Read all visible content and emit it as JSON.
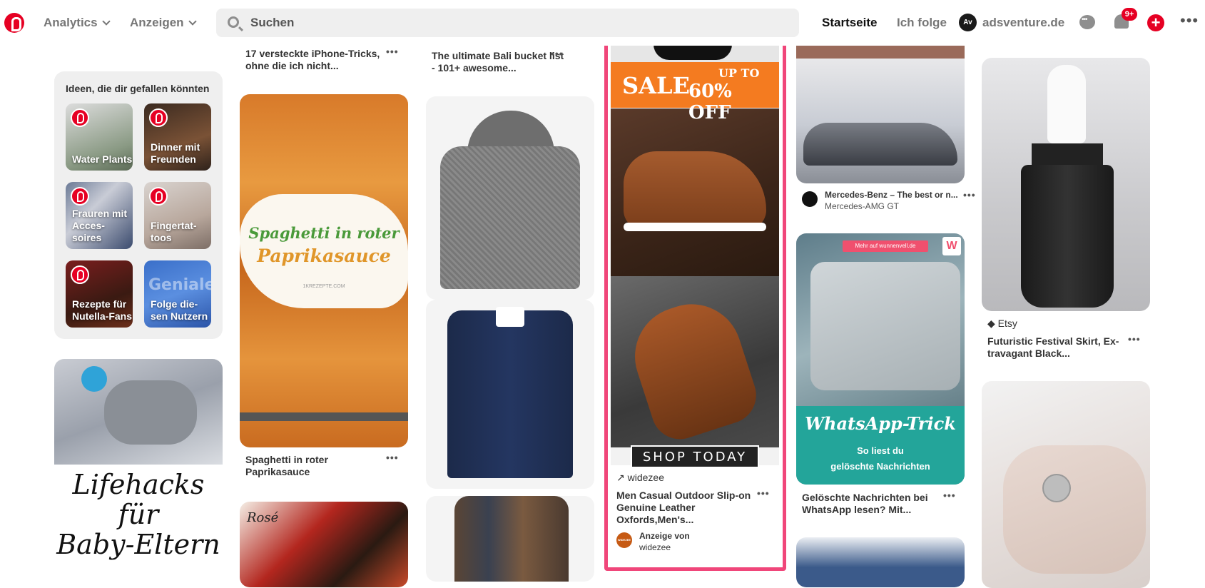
{
  "header": {
    "nav": [
      "Analytics",
      "Anzeigen"
    ],
    "search_placeholder": "Suchen",
    "home": "Startseite",
    "following": "Ich folge",
    "user_name": "adsventure.de",
    "user_avatar_text": "Av",
    "notifications_badge": "9+"
  },
  "ideas": {
    "title": "Ideen, die dir gefallen könnten",
    "items": [
      "Water Plants",
      "Dinner mit Freunden",
      "Frauren mit Acces-soires",
      "Fingertat-toos",
      "Rezepte für Nutella-Fans",
      "Folge die-sen Nutzern"
    ],
    "overlay_word": "Geniale"
  },
  "col1": {
    "pin_text_line1": "Lifehacks",
    "pin_text_line2": "für",
    "pin_text_line3": "Baby-Eltern"
  },
  "col2": {
    "pin1_title": "17 versteckte iPhone-Tricks, ohne die ich nicht...",
    "pin2_overlay_line1": "Spaghetti in roter",
    "pin2_overlay_line2": "Paprikasauce",
    "pin2_watermark": "1KREZEPTE.COM",
    "pin2_title": "Spaghetti in roter Paprikasauce",
    "pin3_overlay": "Rosé"
  },
  "col3": {
    "pin1_title": "The ultimate Bali bucket list - 101+ awesome..."
  },
  "ad": {
    "sale_line1": "SALE",
    "sale_line2": "UP TO",
    "sale_line3": "60% OFF",
    "shop_today": "SHOP TODAY",
    "domain": "widezee",
    "title": "Men Casual Outdoor Slip-on Genuine Leather Oxfords,Men's...",
    "sponsored_label": "Anzeige von",
    "sponsor": "widezee",
    "sponsor_avatar": "WIDEZEE"
  },
  "col5": {
    "pin1_title": "Mercedes-Benz – The best or n...",
    "pin1_subtitle": "Mercedes-AMG GT",
    "pin2_caption": "Mehr auf wunnenvell.de",
    "pin2_w": "W",
    "pin2_overlay_title": "WhatsApp-Trick",
    "pin2_overlay_line1": "So liest du",
    "pin2_overlay_line2": "gelöschte Nachrichten",
    "pin2_title": "Gelöschte Nachrichten bei WhatsApp lesen? Mit..."
  },
  "col6": {
    "pin1_source": "Etsy",
    "pin1_title": "Futuristic Festival Skirt, Ex-travagant Black..."
  },
  "colors": {
    "brand": "#e60023",
    "ad_border": "#f0467a",
    "sale_orange": "#f47b20"
  }
}
